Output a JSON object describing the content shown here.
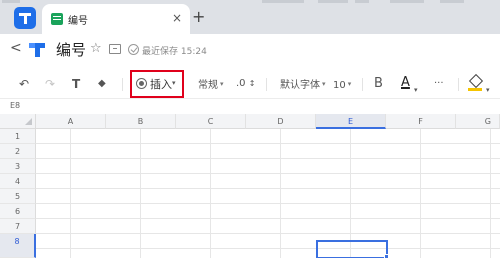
{
  "browser": {
    "tab_title": "编号",
    "new_tab": "+",
    "close": "×"
  },
  "titlebar": {
    "back": "<",
    "doc_title": "编号",
    "star": "☆",
    "save_status": "最近保存 15:24"
  },
  "toolbar": {
    "undo": "↶",
    "redo": "↷",
    "format_painter": "T",
    "clear": "◆",
    "insert_label": "插入",
    "number_format": "常规",
    "decimal": ".0",
    "decimal_arrows": "↕",
    "font_family": "默认字体",
    "font_size": "10",
    "bold": "B",
    "font_color": "A",
    "more": "···",
    "caret": "▾"
  },
  "formula_bar": {
    "cell_ref": "E8"
  },
  "grid": {
    "columns": [
      "A",
      "B",
      "C",
      "D",
      "E",
      "F",
      "G"
    ],
    "rows": [
      "1",
      "2",
      "3",
      "4",
      "5",
      "6",
      "7",
      "8"
    ],
    "selected_column": "E",
    "selected_row": "8"
  },
  "colors": {
    "accent_blue": "#3a6fe0",
    "highlight_red": "#e0001b",
    "fill_yellow": "#f5c400",
    "brand_blue": "#1e6ee8"
  }
}
